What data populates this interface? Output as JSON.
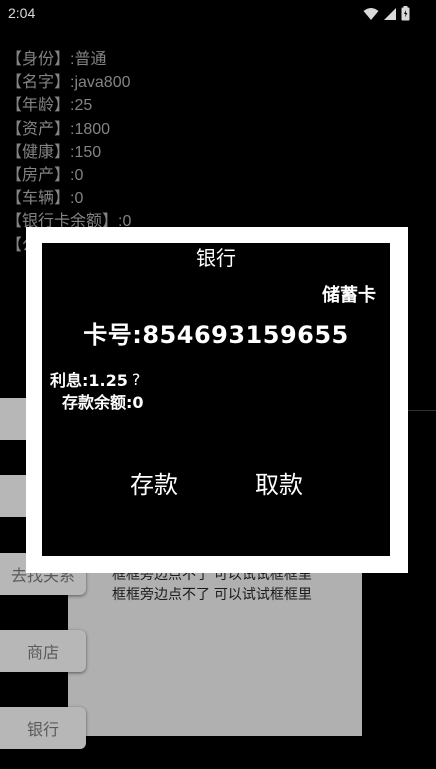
{
  "status_bar": {
    "time": "2:04",
    "icons": [
      "wifi-icon",
      "signal-icon",
      "battery-icon"
    ]
  },
  "stats": [
    "【身份】:普通",
    "【名字】:java800",
    "【年龄】:25",
    "【资产】:1800",
    "【健康】:150",
    "【房产】:0",
    "【车辆】:0",
    "【银行卡余额】:0",
    "【公"
  ],
  "side_buttons": [
    "",
    "",
    "去找关系",
    "商店",
    "银行"
  ],
  "message_box": {
    "lines": [
      "框框旁边点不了 可以试试框框里",
      "框框旁边点不了 可以试试框框里"
    ]
  },
  "dialog": {
    "title": "银行",
    "card_type": "储蓄卡",
    "card_number": "卡号:854693159655",
    "interest": "利息:1.25",
    "help_glyph": "?",
    "balance": "存款余额:0",
    "deposit_label": "存款",
    "withdraw_label": "取款"
  }
}
